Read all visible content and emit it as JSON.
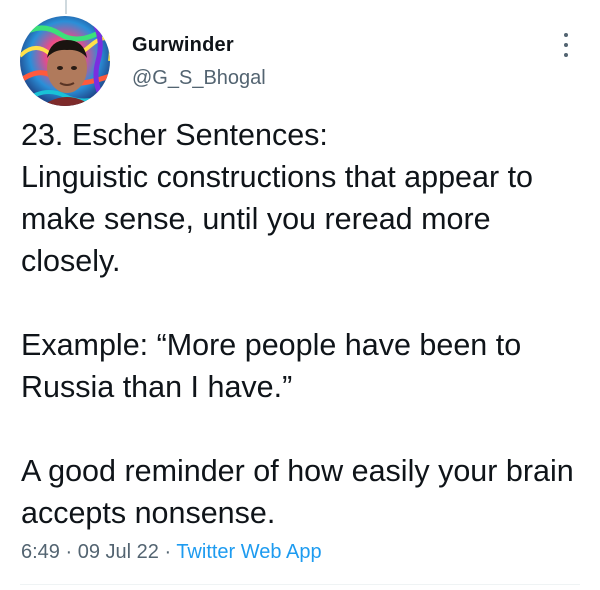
{
  "author": {
    "name": "Gurwinder",
    "handle": "@G_S_Bhogal",
    "avatar_icon": "profile-photo"
  },
  "tweet": {
    "paragraphs": [
      "23. Escher Sentences:\nLinguistic constructions that appear to make sense, until you reread more closely.",
      "Example: “More people have been to Russia than I have.”",
      "A good reminder of how easily your brain accepts nonsense."
    ]
  },
  "meta": {
    "time": "6:49",
    "separator_1": " · ",
    "date": "09 Jul 22",
    "separator_2": " · ",
    "source": "Twitter Web App"
  },
  "colors": {
    "text": "#0f1419",
    "secondary": "#536471",
    "link": "#1d9bf0"
  },
  "icons": {
    "more": "more-vertical-icon"
  }
}
